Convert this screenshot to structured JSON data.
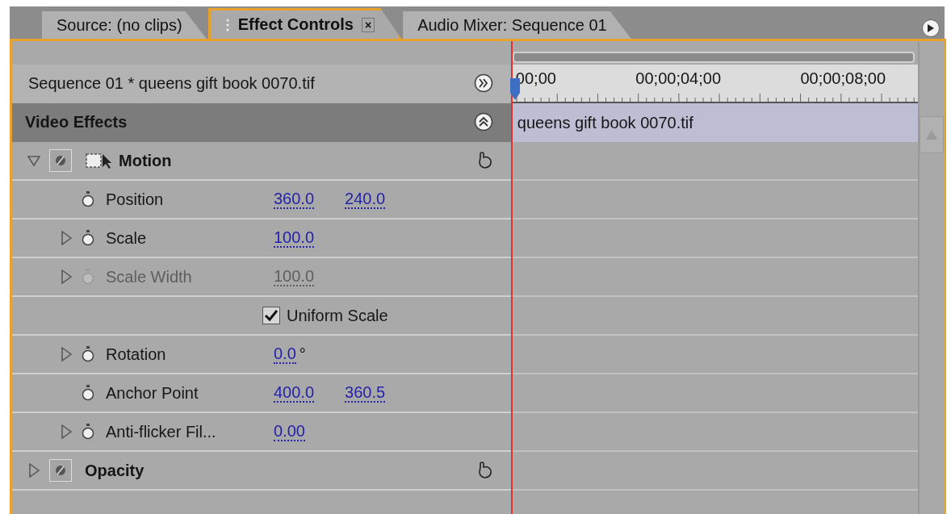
{
  "tabs": [
    {
      "label": "Source: (no clips)",
      "selected": false
    },
    {
      "label": "Effect Controls",
      "selected": true,
      "close": "×"
    },
    {
      "label": "Audio Mixer: Sequence 01",
      "selected": false
    }
  ],
  "sequence_label": "Sequence 01 * queens gift book 0070.tif",
  "ruler": {
    "ticks": [
      "00;00",
      "00;00;04;00",
      "00;00;08;00"
    ]
  },
  "clip_name": "queens gift book 0070.tif",
  "section": {
    "title": "Video Effects"
  },
  "effects": [
    {
      "name": "Motion",
      "expanded": true,
      "properties": [
        {
          "kind": "value",
          "name": "Position",
          "expandable": false,
          "disabled": false,
          "values": [
            "360.0",
            "240.0"
          ]
        },
        {
          "kind": "value",
          "name": "Scale",
          "expandable": true,
          "disabled": false,
          "values": [
            "100.0"
          ]
        },
        {
          "kind": "value",
          "name": "Scale Width",
          "expandable": true,
          "disabled": true,
          "values": [
            "100.0"
          ]
        },
        {
          "kind": "checkbox",
          "label": "Uniform Scale",
          "checked": true
        },
        {
          "kind": "value",
          "name": "Rotation",
          "expandable": true,
          "disabled": false,
          "values": [
            "0.0"
          ],
          "unit": "°"
        },
        {
          "kind": "value",
          "name": "Anchor Point",
          "expandable": false,
          "disabled": false,
          "values": [
            "400.0",
            "360.5"
          ]
        },
        {
          "kind": "value",
          "name": "Anti-flicker Fil...",
          "expandable": true,
          "disabled": false,
          "values": [
            "0.00"
          ]
        }
      ]
    },
    {
      "name": "Opacity",
      "expanded": false
    }
  ]
}
